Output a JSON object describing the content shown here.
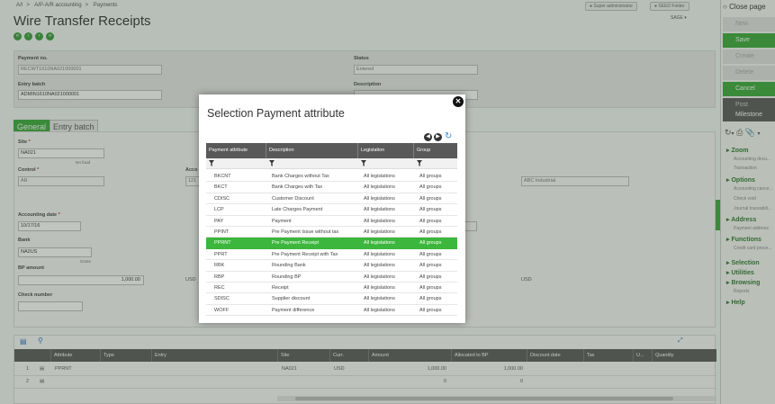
{
  "breadcrumb": [
    "A/I",
    "A/P-A/R accounting",
    "Payments"
  ],
  "header": {
    "user_button": "Super administrator",
    "folder_button": "SEED Folder",
    "title": "Wire Transfer Receipts",
    "sage": "SAGE"
  },
  "form": {
    "payment_no_label": "Payment no.",
    "payment_no_value": "RECWT1610NA021000001",
    "entry_batch_label": "Entry batch",
    "entry_batch_value": "ADMIN1610NA021000001",
    "status_label": "Status",
    "status_value": "Entered",
    "description_label": "Description"
  },
  "tabs": [
    "General",
    "Entry batch"
  ],
  "general": {
    "site_label": "Site",
    "site_value": "NA021",
    "site_note": "NA food",
    "control_label": "Control",
    "control_value": "AR",
    "account_label": "Acco",
    "account_value": "121",
    "customer_name": "ABC Industrial",
    "accounting_date_label": "Accounting date",
    "accounting_date_value": "10/17/16",
    "bank_label": "Bank",
    "bank_value": "NA2US",
    "bank_note": "Cross",
    "bp_amount_label": "BP amount",
    "bp_amount_value": "1,000.00",
    "currency_1": "USD",
    "currency_2": "USD",
    "check_number_label": "Check number"
  },
  "grid": {
    "columns": [
      "Attribute",
      "Type",
      "Entry",
      "Site",
      "Curr.",
      "Amount",
      "Allocated to BP",
      "Discount date",
      "Tax",
      "U...",
      "Quantity"
    ],
    "rows": [
      {
        "num": "1",
        "attribute": "PPRNT",
        "site": "NA021",
        "curr": "USD",
        "amount": "1,000.00",
        "allocated": "1,000.00"
      },
      {
        "num": "2",
        "attribute": "",
        "site": "",
        "curr": "",
        "amount": "0",
        "allocated": "0"
      }
    ]
  },
  "rightbar": {
    "close_page": "Close page",
    "actions": [
      "New",
      "Save",
      "Create",
      "Delete",
      "Cancel",
      "Post",
      "Milestone"
    ],
    "sections": [
      {
        "title": "Zoom",
        "items": [
          "Accounting docu...",
          "Transaction"
        ]
      },
      {
        "title": "Options",
        "items": [
          "Accounting cance...",
          "Check void",
          "Journal traceabili..."
        ]
      },
      {
        "title": "Address",
        "items": [
          "Payment address"
        ]
      },
      {
        "title": "Functions",
        "items": [
          "Credit card proce..."
        ]
      },
      {
        "title": "Selection",
        "items": []
      },
      {
        "title": "Utilities",
        "items": []
      },
      {
        "title": "Browsing",
        "items": [
          "Reports"
        ]
      },
      {
        "title": "Help",
        "items": []
      }
    ]
  },
  "modal": {
    "title": "Selection Payment attribute",
    "columns": [
      "Payment attribute",
      "Description",
      "Legislation",
      "Group"
    ],
    "rows": [
      {
        "code": "BKCNT",
        "description": "Bank Charges without Tax",
        "legislation": "All legislations",
        "group": "All groups"
      },
      {
        "code": "BKCT",
        "description": "Bank Charges with Tax",
        "legislation": "All legislations",
        "group": "All groups"
      },
      {
        "code": "CDISC",
        "description": "Customer Discount",
        "legislation": "All legislations",
        "group": "All groups"
      },
      {
        "code": "LCP",
        "description": "Late Charges Payment",
        "legislation": "All legislations",
        "group": "All groups"
      },
      {
        "code": "PAY",
        "description": "Payment",
        "legislation": "All legislations",
        "group": "All groups"
      },
      {
        "code": "PPINT",
        "description": "Pre Payment Issue without tax",
        "legislation": "All legislations",
        "group": "All groups"
      },
      {
        "code": "PPRNT",
        "description": "Pre Payment Receipt",
        "legislation": "All legislations",
        "group": "All groups"
      },
      {
        "code": "PPRT",
        "description": "Pre Payment Receipt with Tax",
        "legislation": "All legislations",
        "group": "All groups"
      },
      {
        "code": "RBK",
        "description": "Rounding Bank",
        "legislation": "All legislations",
        "group": "All groups"
      },
      {
        "code": "RBP",
        "description": "Rounding BP",
        "legislation": "All legislations",
        "group": "All groups"
      },
      {
        "code": "REC",
        "description": "Receipt",
        "legislation": "All legislations",
        "group": "All groups"
      },
      {
        "code": "SDISC",
        "description": "Supplier discount",
        "legislation": "All legislations",
        "group": "All groups"
      },
      {
        "code": "WOFF",
        "description": "Payment difference",
        "legislation": "All legislations",
        "group": "All groups"
      }
    ],
    "selected_index": 6
  },
  "colors": {
    "accent": "#3aa83a",
    "selected_row": "#3cb63c",
    "header_dark": "#595959"
  }
}
